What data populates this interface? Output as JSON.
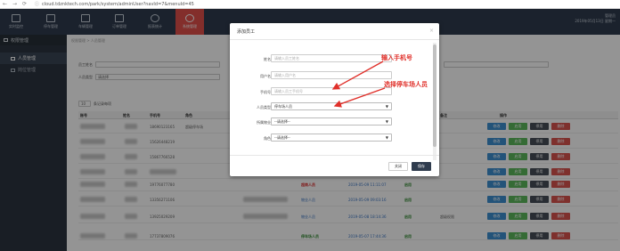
{
  "browser": {
    "url": "cloud.tdznktech.com/park/system/adminUser?navId=7&menuId=45"
  },
  "topnav": {
    "items": [
      {
        "label": "实时监控"
      },
      {
        "label": "停车管理"
      },
      {
        "label": "车辆管理"
      },
      {
        "label": "订单管理"
      },
      {
        "label": "报表统计"
      },
      {
        "label": "系统管理"
      }
    ],
    "user": "管理员",
    "datetime": "2019年05月13日 星期一"
  },
  "sidebar": {
    "header": "权限管理",
    "items": [
      {
        "label": "人员管理"
      },
      {
        "label": "岗位管理"
      }
    ]
  },
  "breadcrumb": "权限管理 > 人员管理",
  "filters": {
    "name_label": "员工姓名",
    "type_label": "人员类型",
    "type_value": "请选择"
  },
  "table": {
    "page_size": "10",
    "page_size_suffix": "条记录每项",
    "headers": [
      "账号",
      "姓名",
      "手机号",
      "角色",
      "",
      "",
      "人员类型",
      "创建时间",
      "状态",
      "备注",
      "操作"
    ],
    "rows": [
      {
        "name": "",
        "phone": "18690123165",
        "role": "超级停车场",
        "type": "",
        "time": "",
        "status": "",
        "remark": ""
      },
      {
        "name": "",
        "phone": "15626448219",
        "role": "",
        "type": "",
        "time": "",
        "status": "",
        "remark": ""
      },
      {
        "name": "",
        "phone": "15867766528",
        "role": "",
        "type": "",
        "time": "",
        "status": "",
        "remark": ""
      },
      {
        "name": "",
        "phone": "",
        "role": "",
        "type": "",
        "time": "",
        "status": "",
        "remark": ""
      },
      {
        "name": "",
        "phone": "19776077780",
        "role": "",
        "type": "超商人员",
        "time": "2019-05-09 11:11:07",
        "status": "启用",
        "remark": ""
      },
      {
        "name": "",
        "phone": "13356271106",
        "role": "",
        "type": "物业人员",
        "time": "2019-05-09 09:03:16",
        "status": "启用",
        "remark": ""
      },
      {
        "name": "",
        "phone": "13925029209",
        "role": "",
        "type": "物业人员",
        "time": "2019-05-08 18:14:36",
        "status": "启用",
        "remark": "超级权限"
      },
      {
        "name": "",
        "phone": "17737809076",
        "role": "",
        "type": "停车场人员",
        "time": "2019-05-07 17:44:36",
        "status": "启用",
        "remark": ""
      }
    ],
    "actions": {
      "edit": "修改",
      "enable": "启用",
      "disable": "停用",
      "delete": "删除"
    }
  },
  "modal": {
    "title": "添加员工",
    "fields": {
      "name": {
        "label": "姓名",
        "placeholder": "请输入员工姓名"
      },
      "username": {
        "label": "用户名",
        "placeholder": "请输入用户名"
      },
      "phone": {
        "label": "手机号",
        "placeholder": "请输入员工手机号"
      },
      "type": {
        "label": "人员类型",
        "value": "停车场人员"
      },
      "park": {
        "label": "所属物业",
        "value": "--请选择--"
      },
      "role": {
        "label": "角色",
        "value": "--请选择--"
      }
    },
    "cancel": "关闭",
    "save": "保存"
  },
  "annotations": {
    "phone": "输入手机号",
    "type": "选择停车场人员",
    "color": "#e0302a"
  }
}
